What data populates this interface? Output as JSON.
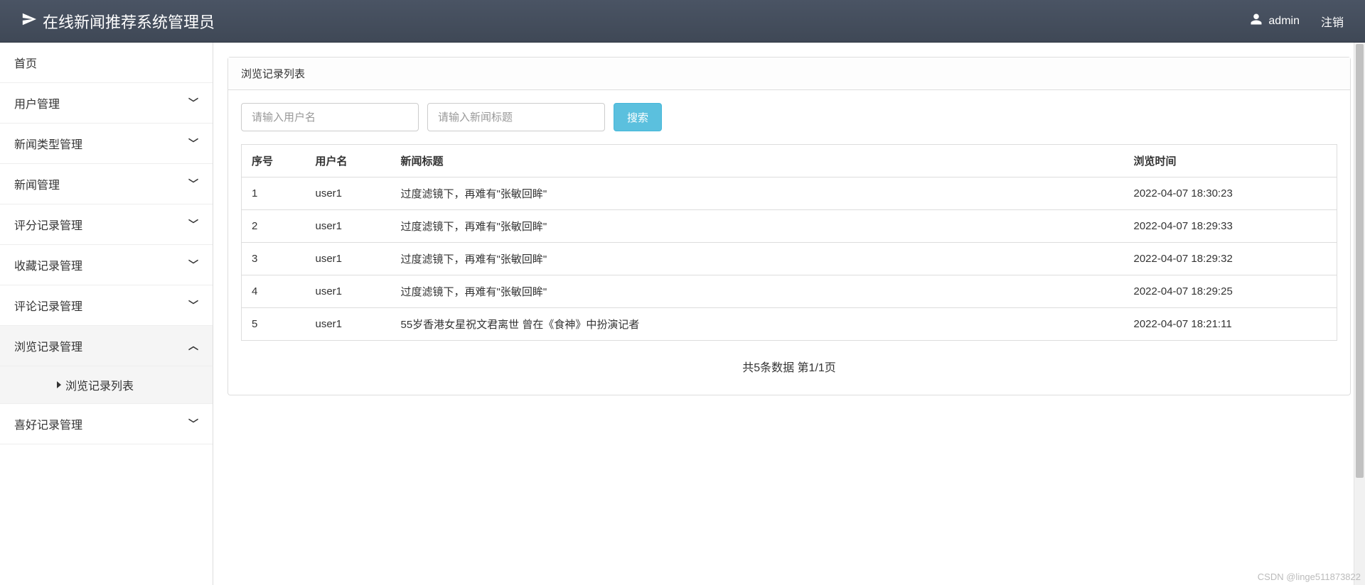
{
  "header": {
    "app_title": "在线新闻推荐系统管理员",
    "username": "admin",
    "logout": "注销"
  },
  "sidebar": {
    "items": [
      {
        "label": "首页",
        "has_children": false,
        "expanded": false
      },
      {
        "label": "用户管理",
        "has_children": true,
        "expanded": false
      },
      {
        "label": "新闻类型管理",
        "has_children": true,
        "expanded": false
      },
      {
        "label": "新闻管理",
        "has_children": true,
        "expanded": false
      },
      {
        "label": "评分记录管理",
        "has_children": true,
        "expanded": false
      },
      {
        "label": "收藏记录管理",
        "has_children": true,
        "expanded": false
      },
      {
        "label": "评论记录管理",
        "has_children": true,
        "expanded": false
      },
      {
        "label": "浏览记录管理",
        "has_children": true,
        "expanded": true,
        "subitems": [
          {
            "label": "浏览记录列表"
          }
        ]
      },
      {
        "label": "喜好记录管理",
        "has_children": true,
        "expanded": false
      }
    ]
  },
  "main": {
    "panel_title": "浏览记录列表",
    "search": {
      "username_placeholder": "请输入用户名",
      "title_placeholder": "请输入新闻标题",
      "button": "搜索"
    },
    "table": {
      "columns": [
        "序号",
        "用户名",
        "新闻标题",
        "浏览时间"
      ],
      "rows": [
        {
          "seq": "1",
          "user": "user1",
          "title": "过度滤镜下，再难有\"张敏回眸\"",
          "time": "2022-04-07 18:30:23"
        },
        {
          "seq": "2",
          "user": "user1",
          "title": "过度滤镜下，再难有\"张敏回眸\"",
          "time": "2022-04-07 18:29:33"
        },
        {
          "seq": "3",
          "user": "user1",
          "title": "过度滤镜下，再难有\"张敏回眸\"",
          "time": "2022-04-07 18:29:32"
        },
        {
          "seq": "4",
          "user": "user1",
          "title": "过度滤镜下，再难有\"张敏回眸\"",
          "time": "2022-04-07 18:29:25"
        },
        {
          "seq": "5",
          "user": "user1",
          "title": "55岁香港女星祝文君离世 曾在《食神》中扮演记者",
          "time": "2022-04-07 18:21:11"
        }
      ]
    },
    "pagination": "共5条数据  第1/1页"
  },
  "watermark": "CSDN @linge511873822"
}
